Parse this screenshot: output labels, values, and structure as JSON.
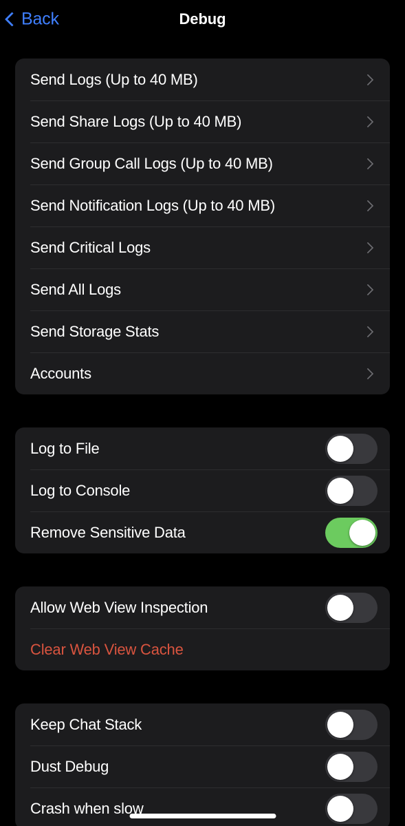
{
  "nav": {
    "back_label": "Back",
    "back_icon": "chevron-left-icon",
    "title": "Debug"
  },
  "colors": {
    "background": "#000000",
    "card": "#1c1c1e",
    "separator": "#2e2e30",
    "accent_blue": "#3f7fff",
    "toggle_on_green": "#6ccb5f",
    "toggle_off_track": "#39393d",
    "destructive_red": "#d9543f",
    "chevron_gray": "#6a6a6e",
    "text_primary": "#ffffff"
  },
  "sections": [
    {
      "id": "logs",
      "rows": [
        {
          "label": "Send Logs (Up to 40 MB)",
          "type": "disclosure",
          "icon": "chevron-right-icon"
        },
        {
          "label": "Send Share Logs (Up to 40 MB)",
          "type": "disclosure",
          "icon": "chevron-right-icon"
        },
        {
          "label": "Send Group Call Logs (Up to 40 MB)",
          "type": "disclosure",
          "icon": "chevron-right-icon"
        },
        {
          "label": "Send Notification Logs (Up to 40 MB)",
          "type": "disclosure",
          "icon": "chevron-right-icon"
        },
        {
          "label": "Send Critical Logs",
          "type": "disclosure",
          "icon": "chevron-right-icon"
        },
        {
          "label": "Send All Logs",
          "type": "disclosure",
          "icon": "chevron-right-icon"
        },
        {
          "label": "Send Storage Stats",
          "type": "disclosure",
          "icon": "chevron-right-icon"
        },
        {
          "label": "Accounts",
          "type": "disclosure",
          "icon": "chevron-right-icon"
        }
      ]
    },
    {
      "id": "logging",
      "rows": [
        {
          "label": "Log to File",
          "type": "toggle",
          "value": false
        },
        {
          "label": "Log to Console",
          "type": "toggle",
          "value": false
        },
        {
          "label": "Remove Sensitive Data",
          "type": "toggle",
          "value": true
        }
      ]
    },
    {
      "id": "webview",
      "rows": [
        {
          "label": "Allow Web View Inspection",
          "type": "toggle",
          "value": false
        },
        {
          "label": "Clear Web View Cache",
          "type": "destructive"
        }
      ]
    },
    {
      "id": "misc",
      "rows": [
        {
          "label": "Keep Chat Stack",
          "type": "toggle",
          "value": false
        },
        {
          "label": "Dust Debug",
          "type": "toggle",
          "value": false
        },
        {
          "label": "Crash when slow",
          "type": "toggle",
          "value": false
        }
      ]
    }
  ]
}
